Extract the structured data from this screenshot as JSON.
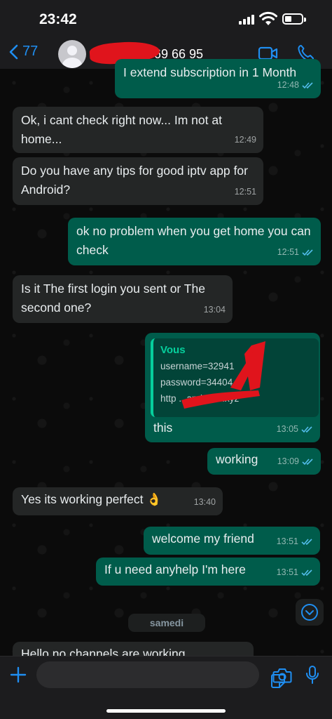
{
  "status_bar": {
    "time": "23:42"
  },
  "header": {
    "back_count": "77",
    "contact_name": "369 66 95"
  },
  "messages": [
    {
      "dir": "out",
      "text": "I extend subscription  in 1 Month",
      "time": "12:48"
    },
    {
      "dir": "in",
      "text": "Ok, i cant check right now... Im not at home...",
      "time": "12:49"
    },
    {
      "dir": "in",
      "text": "Do you have any tips for good iptv app for Android?",
      "time": "12:51"
    },
    {
      "dir": "out",
      "text": "ok no problem when you get home you can check",
      "time": "12:51"
    },
    {
      "dir": "in",
      "text": "Is it The first login you sent or The second one?",
      "time": "13:04"
    },
    {
      "dir": "out",
      "text": "this",
      "time": "13:05",
      "quote": {
        "author": "Vous",
        "line1": "username=32941",
        "line2": "password=34404",
        "line3": "http               ...aprimetv.xyz"
      }
    },
    {
      "dir": "out",
      "text": "working",
      "time": "13:09"
    },
    {
      "dir": "in",
      "text": "Yes its working perfect 👌",
      "time": "13:40"
    },
    {
      "dir": "out",
      "text": "welcome my friend",
      "time": "13:51"
    },
    {
      "dir": "out",
      "text": "If u need anyhelp I'm here",
      "time": "13:51"
    },
    {
      "dir": "in",
      "text": "Hello no channels are working",
      "time": ""
    }
  ],
  "date_separator": "samedi",
  "colors": {
    "incoming_bubble": "#242626",
    "outgoing_bubble": "#005c4b",
    "accent_blue": "#1f8ef1",
    "read_ticks": "#53bdeb",
    "redaction": "#e0141c"
  },
  "icons": [
    "back-chevron-icon",
    "avatar-icon",
    "video-call-icon",
    "phone-icon",
    "read-ticks-icon",
    "chevron-down-icon",
    "plus-icon",
    "sticker-icon",
    "camera-icon",
    "microphone-icon"
  ]
}
